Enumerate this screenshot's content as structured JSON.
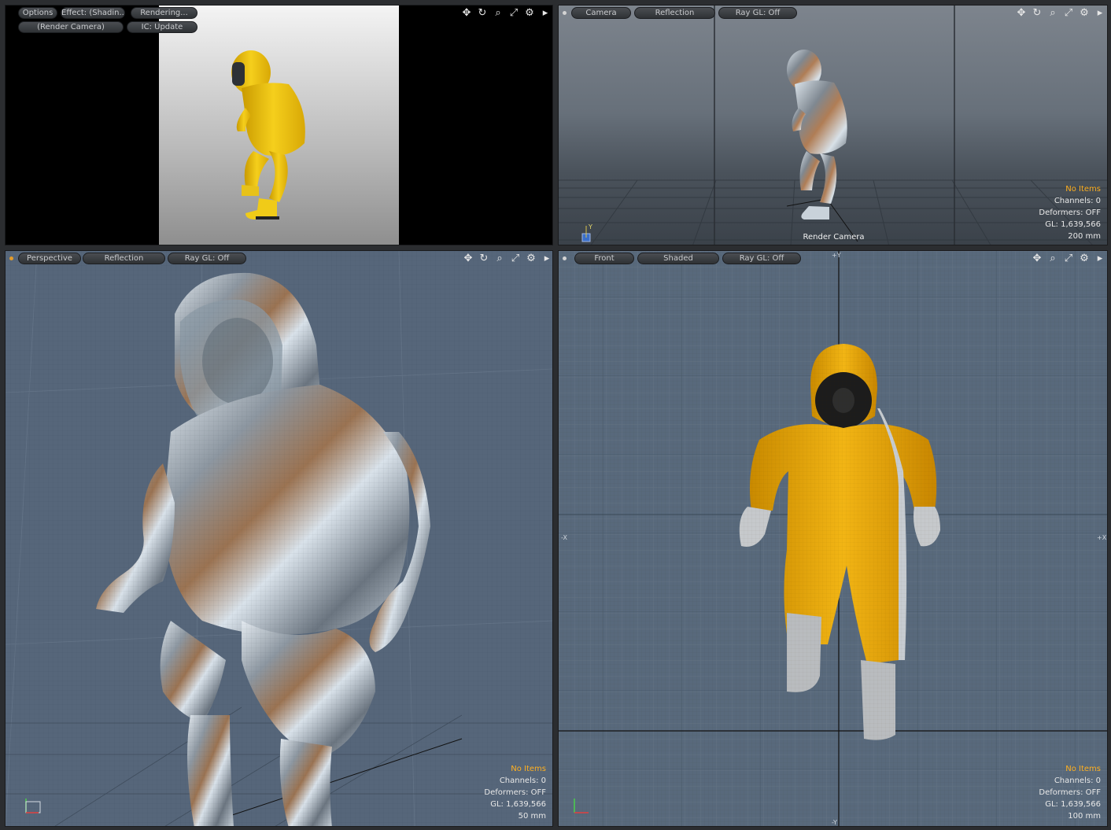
{
  "render_view": {
    "buttons": [
      "Options",
      "Effect: (Shadin...",
      "Rendering...",
      "(Render Camera)",
      "IC: Update"
    ]
  },
  "camera_view": {
    "tabs": [
      "Camera",
      "Reflection",
      "Ray GL: Off"
    ],
    "bottom_label": "Render Camera",
    "info": {
      "items": "No Items",
      "channels": "Channels: 0",
      "deformers": "Deformers: OFF",
      "gl": "GL: 1,639,566",
      "scale": "200 mm"
    }
  },
  "perspective_view": {
    "tabs": [
      "Perspective",
      "Reflection",
      "Ray GL: Off"
    ],
    "info": {
      "items": "No Items",
      "channels": "Channels: 0",
      "deformers": "Deformers: OFF",
      "gl": "GL: 1,639,566",
      "scale": "50 mm"
    }
  },
  "front_view": {
    "tabs": [
      "Front",
      "Shaded",
      "Ray GL: Off"
    ],
    "axes": {
      "top": "+Y",
      "bottom": "-Y",
      "left": "-X",
      "right": "+X"
    },
    "info": {
      "items": "No Items",
      "channels": "Channels: 0",
      "deformers": "Deformers: OFF",
      "gl": "GL: 1,639,566",
      "scale": "100 mm"
    }
  },
  "tool_icons": [
    "move-icon",
    "rotate-icon",
    "zoom-icon",
    "maximize-icon",
    "settings-icon",
    "expand-arrow-icon"
  ],
  "colors": {
    "highlight": "#ffb020",
    "suit_yellow": "#e8b40c",
    "chrome": "#b8c4cf"
  }
}
